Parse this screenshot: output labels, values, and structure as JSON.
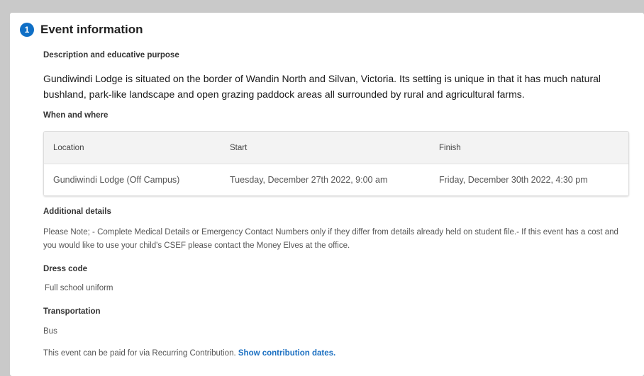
{
  "step": {
    "number": "1",
    "title": "Event information"
  },
  "description": {
    "label": "Description and educative purpose",
    "text": "Gundiwindi Lodge is situated on the border of Wandin North and Silvan, Victoria. Its setting is unique in that it has much natural bushland, park-like landscape and open grazing paddock areas all surrounded by rural and agricultural farms."
  },
  "when_where": {
    "label": "When and where",
    "columns": [
      "Location",
      "Start",
      "Finish"
    ],
    "rows": [
      [
        "Gundiwindi Lodge  (Off Campus)",
        "Tuesday, December 27th 2022, 9:00 am",
        "Friday, December 30th 2022, 4:30 pm"
      ]
    ]
  },
  "additional": {
    "label": "Additional details",
    "text": "Please Note; - Complete Medical Details or Emergency Contact Numbers only if they differ from details already held on student file.- If this event has a cost and you would like to use your child's CSEF please contact the Money Elves at the office."
  },
  "dress_code": {
    "label": "Dress code",
    "value": "Full school uniform"
  },
  "transportation": {
    "label": "Transportation",
    "value": "Bus"
  },
  "contribution": {
    "text": "This event can be paid for via Recurring Contribution.",
    "link": "Show contribution dates."
  },
  "colors": {
    "accent": "#0f6fc6",
    "link": "#1a6fc1"
  }
}
